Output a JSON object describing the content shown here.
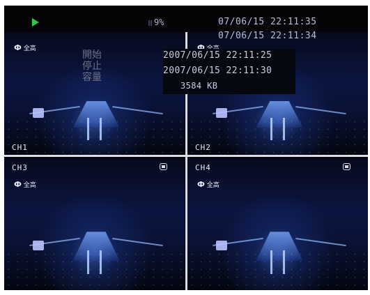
{
  "status": {
    "play_icon": "play-icon",
    "hdd_usage": "9%",
    "time_primary": "07/06/15 22:11:35",
    "time_secondary": "07/06/15 22:11:34",
    "accent_color": "#2fc54a"
  },
  "overlay": {
    "labels": [
      "開始",
      "停止",
      "容量"
    ],
    "start_time": "2007/06/15 22:11:25",
    "stop_time": "2007/06/15 22:11:30",
    "size": "3584 KB"
  },
  "channels": [
    {
      "label": "CH1",
      "logo": "全高",
      "recording": false
    },
    {
      "label": "CH2",
      "logo": "全高",
      "recording": false
    },
    {
      "label": "CH3",
      "logo": "全高",
      "recording": true
    },
    {
      "label": "CH4",
      "logo": "全高",
      "recording": true
    }
  ]
}
